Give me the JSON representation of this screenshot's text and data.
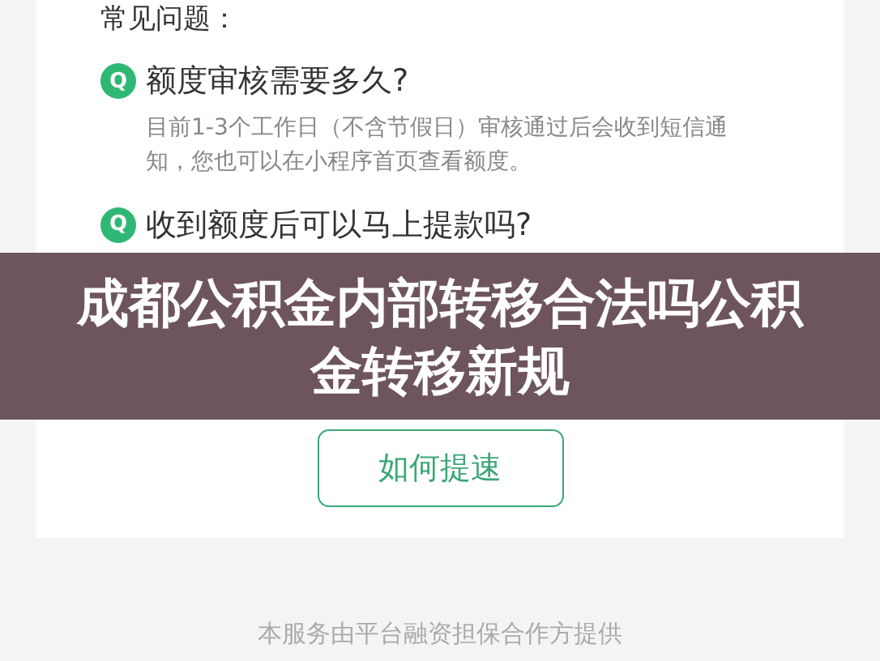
{
  "section_title": "常见问题：",
  "faq": [
    {
      "marker": "Q",
      "question": "额度审核需要多久?",
      "answer": "目前1-3个工作日（不含节假日）审核通过后会收到短信通知，您也可以在小程序首页查看额度。"
    },
    {
      "marker": "Q",
      "question": "收到额度后可以马上提款吗?"
    }
  ],
  "action_button": "如何提速",
  "footer": "本服务由平台融资担保合作方提供",
  "overlay_title": "成都公积金内部转移合法吗公积金转移新规"
}
